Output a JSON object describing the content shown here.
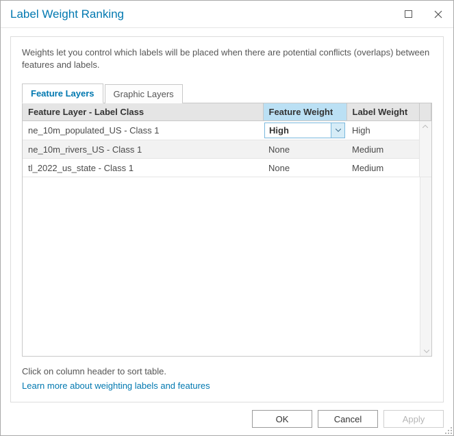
{
  "window": {
    "title": "Label Weight Ranking"
  },
  "intro": "Weights let you control which labels will be placed when there are potential conflicts (overlaps) between features and labels.",
  "tabs": [
    {
      "label": "Feature Layers",
      "active": true
    },
    {
      "label": "Graphic Layers",
      "active": false
    }
  ],
  "columns": {
    "layer": "Feature Layer - Label Class",
    "feature_weight": "Feature Weight",
    "label_weight": "Label Weight"
  },
  "rows": [
    {
      "layer": "ne_10m_populated_US - Class 1",
      "feature_weight": "High",
      "label_weight": "High",
      "fw_active_dropdown": true
    },
    {
      "layer": "ne_10m_rivers_US - Class 1",
      "feature_weight": "None",
      "label_weight": "Medium",
      "alt": true
    },
    {
      "layer": "tl_2022_us_state - Class 1",
      "feature_weight": "None",
      "label_weight": "Medium"
    }
  ],
  "sort_hint": "Click on column header to sort table.",
  "learn_more": "Learn more about weighting labels and features",
  "buttons": {
    "ok": "OK",
    "cancel": "Cancel",
    "apply": "Apply"
  }
}
